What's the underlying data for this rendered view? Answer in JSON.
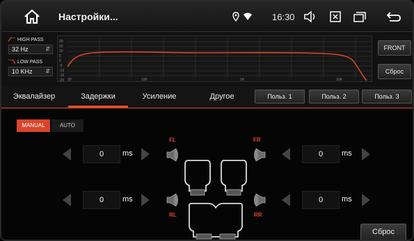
{
  "header": {
    "title": "Настройки...",
    "time": "16:30"
  },
  "filters": {
    "high_pass": {
      "label": "HIGH PASS",
      "value": "32 Hz"
    },
    "low_pass": {
      "label": "LOW PASS",
      "value": "10 KHz"
    }
  },
  "eq_graph": {
    "y_ticks": [
      "20",
      "15",
      "10",
      "5",
      "0",
      "-5",
      "-10",
      "-15",
      "-20"
    ],
    "x_ticks": [
      "20",
      "100",
      "1K",
      "10K"
    ]
  },
  "side_buttons": {
    "front": "FRONT",
    "reset": "Сброс"
  },
  "tabs": [
    {
      "label": "Эквалайзер"
    },
    {
      "label": "Задержки"
    },
    {
      "label": "Усиление"
    },
    {
      "label": "Другое"
    }
  ],
  "active_tab": "Задержки",
  "presets": [
    "Польз. 1",
    "Польз. 2",
    "Польз. 3"
  ],
  "mode": {
    "manual": "MANUAL",
    "auto": "AUTO",
    "selected": "MANUAL"
  },
  "delays": {
    "fl": {
      "label": "FL",
      "value": "0",
      "unit": "ms"
    },
    "fr": {
      "label": "FR",
      "value": "0",
      "unit": "ms"
    },
    "rl": {
      "label": "RL",
      "value": "0",
      "unit": "ms"
    },
    "rr": {
      "label": "RR",
      "value": "0",
      "unit": "ms"
    }
  },
  "reset_label": "Сброс",
  "colors": {
    "accent": "#e24c2c",
    "curve": "#d9452a"
  }
}
